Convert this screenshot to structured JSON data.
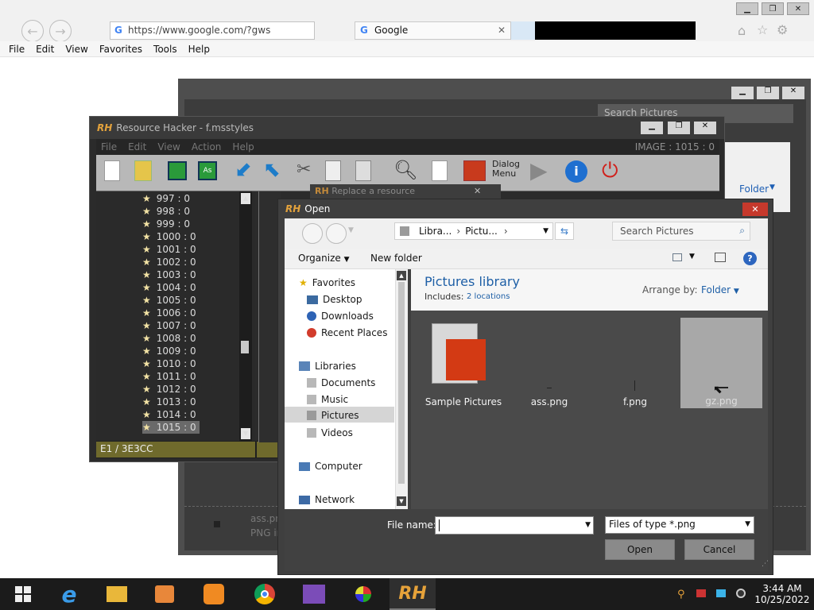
{
  "browser": {
    "address": "https://www.google.com/?gws",
    "tab_title": "Google",
    "menu": [
      "File",
      "Edit",
      "View",
      "Favorites",
      "Tools",
      "Help"
    ]
  },
  "rh": {
    "title": "Resource Hacker - f.msstyles",
    "menu": [
      "File",
      "Edit",
      "View",
      "Action",
      "Help"
    ],
    "image_label": "IMAGE : 1015 : 0",
    "tree_items": [
      "997 : 0",
      "998 : 0",
      "999 : 0",
      "1000 : 0",
      "1001 : 0",
      "1002 : 0",
      "1003 : 0",
      "1004 : 0",
      "1005 : 0",
      "1006 : 0",
      "1007 : 0",
      "1008 : 0",
      "1009 : 0",
      "1010 : 0",
      "1011 : 0",
      "1012 : 0",
      "1013 : 0",
      "1014 : 0",
      "1015 : 0"
    ],
    "status_left": "E1 / 3E3CC",
    "dialog_label": "Dialog Menu"
  },
  "replace_dialog": {
    "title": "Replace a resource"
  },
  "back_window": {
    "search_placeholder": "Search Pictures",
    "arrange": "Folder",
    "bottom_file": "ass.png",
    "bottom_type": "PNG im"
  },
  "open": {
    "title": "Open",
    "breadcrumb": [
      "Libra...",
      "Pictu..."
    ],
    "search_placeholder": "Search Pictures",
    "organize": "Organize",
    "new_folder": "New folder",
    "library_title": "Pictures library",
    "includes_label": "Includes:",
    "includes_link": "2 locations",
    "arrange_label": "Arrange by:",
    "arrange_value": "Folder",
    "nav": {
      "favorites": "Favorites",
      "desktop": "Desktop",
      "downloads": "Downloads",
      "recent": "Recent Places",
      "libraries": "Libraries",
      "documents": "Documents",
      "music": "Music",
      "pictures": "Pictures",
      "videos": "Videos",
      "computer": "Computer",
      "network": "Network"
    },
    "files": [
      "Sample Pictures",
      "ass.png",
      "f.png",
      "gz.png"
    ],
    "filename_label": "File name:",
    "filename_value": "",
    "filetype": "Files of type *.png",
    "open_btn": "Open",
    "cancel_btn": "Cancel"
  },
  "clock": {
    "time": "3:44 AM",
    "date": "10/25/2022"
  }
}
